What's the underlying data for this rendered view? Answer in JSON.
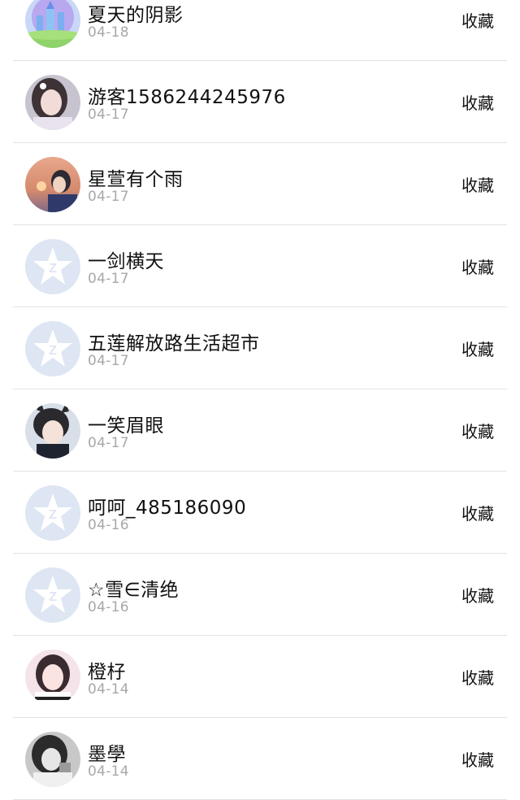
{
  "friends": [
    {
      "name": "夏天的阴影",
      "date": "04-18",
      "action": "收藏",
      "avatar": "castle-avatar"
    },
    {
      "name": "游客1586244245976",
      "date": "04-17",
      "action": "收藏",
      "avatar": "girl-photo-avatar"
    },
    {
      "name": "星萱有个雨",
      "date": "04-17",
      "action": "收藏",
      "avatar": "sunset-girl-avatar"
    },
    {
      "name": "一剑横天",
      "date": "04-17",
      "action": "收藏",
      "avatar": "default-z-avatar"
    },
    {
      "name": "五莲解放路生活超市",
      "date": "04-17",
      "action": "收藏",
      "avatar": "default-z-avatar"
    },
    {
      "name": "一笑眉眼",
      "date": "04-17",
      "action": "收藏",
      "avatar": "anime-boy-avatar"
    },
    {
      "name": "呵呵_485186090",
      "date": "04-16",
      "action": "收藏",
      "avatar": "default-z-avatar"
    },
    {
      "name": "☆雪∈清绝",
      "date": "04-16",
      "action": "收藏",
      "avatar": "default-z-avatar"
    },
    {
      "name": "橙杍",
      "date": "04-14",
      "action": "收藏",
      "avatar": "girl-pink-avatar"
    },
    {
      "name": "墨學",
      "date": "04-14",
      "action": "收藏",
      "avatar": "bw-girl-avatar"
    }
  ],
  "colors": {
    "text": "#111111",
    "date": "#a8a8a8",
    "divider": "#e2e2e2",
    "default_avatar_bg": "#dde6f2",
    "default_avatar_star": "#ffffff"
  }
}
